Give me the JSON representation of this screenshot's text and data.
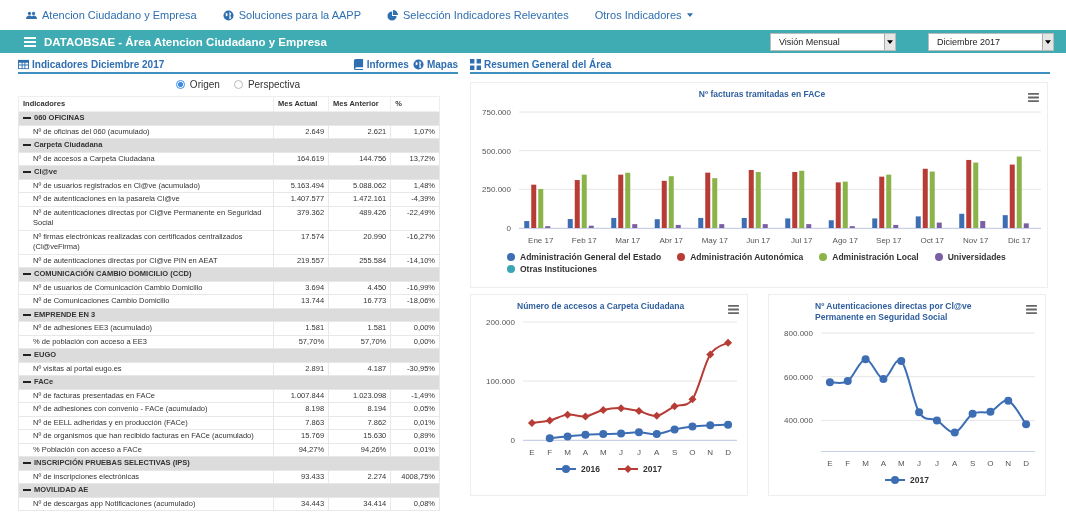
{
  "nav": {
    "items": [
      {
        "label": "Atencion Ciudadano y Empresa",
        "kind": "users"
      },
      {
        "label": "Soluciones para la AAPP",
        "kind": "globe"
      },
      {
        "label": "Selección Indicadores Relevantes",
        "kind": "pie"
      },
      {
        "label": "Otros Indicadores",
        "kind": "dropdown"
      }
    ]
  },
  "header": {
    "title": "DATAOBSAE - Área Atencion Ciudadano y Empresa",
    "selects": [
      {
        "value": "Visión Mensual"
      },
      {
        "value": "Diciembre 2017"
      }
    ]
  },
  "indicators": {
    "title": "Indicadores Diciembre 2017",
    "links": [
      {
        "label": "Informes",
        "kind": "book"
      },
      {
        "label": "Mapas",
        "kind": "globe"
      }
    ],
    "views": [
      {
        "label": "Origen",
        "selected": true
      },
      {
        "label": "Perspectiva",
        "selected": false
      }
    ],
    "columns": [
      "Indicadores",
      "Mes Actual",
      "Mes Anterior",
      "%"
    ],
    "sections": [
      {
        "title": "060 OFICINAS",
        "expanded": true,
        "rows": [
          [
            "Nº de oficinas del 060 (acumulado)",
            "2.649",
            "2.621",
            "1,07%"
          ]
        ]
      },
      {
        "title": "Carpeta Ciudadana",
        "expanded": true,
        "rows": [
          [
            "Nº de accesos a Carpeta Ciudadana",
            "164.619",
            "144.756",
            "13,72%"
          ]
        ]
      },
      {
        "title": "Cl@ve",
        "expanded": true,
        "rows": [
          [
            "Nº de usuarios registrados en Cl@ve (acumulado)",
            "5.163.494",
            "5.088.062",
            "1,48%"
          ],
          [
            "Nº de autenticaciones en la pasarela Cl@ve",
            "1.407.577",
            "1.472.161",
            "-4,39%"
          ],
          [
            "Nº de autenticaciones directas por Cl@ve Permanente en Seguridad Social",
            "379.362",
            "489.426",
            "-22,49%"
          ],
          [
            "Nº firmas electrónicas realizadas con certificados centralizados (Cl@veFirma)",
            "17.574",
            "20.990",
            "-16,27%"
          ],
          [
            "Nº de autenticaciones directas por Cl@ve PIN en AEAT",
            "219.557",
            "255.584",
            "-14,10%"
          ]
        ]
      },
      {
        "title": "COMUNICACIÓN CAMBIO DOMICILIO (CCD)",
        "expanded": true,
        "rows": [
          [
            "Nº de usuarios de Comunicación Cambio Domicilio",
            "3.694",
            "4.450",
            "-16,99%"
          ],
          [
            "Nº de Comunicaciones Cambio Domicilio",
            "13.744",
            "16.773",
            "-18,06%"
          ]
        ]
      },
      {
        "title": "EMPRENDE EN 3",
        "expanded": true,
        "rows": [
          [
            "Nº de adhesiones EE3 (acumulado)",
            "1.581",
            "1.581",
            "0,00%"
          ],
          [
            "% de población con acceso a EE3",
            "57,70%",
            "57,70%",
            "0,00%"
          ]
        ]
      },
      {
        "title": "EUGO",
        "expanded": true,
        "rows": [
          [
            "Nº visitas al portal eugo.es",
            "2.891",
            "4.187",
            "-30,95%"
          ]
        ]
      },
      {
        "title": "FACe",
        "expanded": true,
        "rows": [
          [
            "Nº de facturas presentadas en FACe",
            "1.007.844",
            "1.023.098",
            "-1,49%"
          ],
          [
            "Nº de adhesiones con convenio - FACe (acumulado)",
            "8.198",
            "8.194",
            "0,05%"
          ],
          [
            "Nº de EELL adheridas y en producción (FACe)",
            "7.863",
            "7.862",
            "0,01%"
          ],
          [
            "Nº de organismos que han recibido facturas en FACe (acumulado)",
            "15.769",
            "15.630",
            "0,89%"
          ],
          [
            "% Población con acceso a FACe",
            "94,27%",
            "94,26%",
            "0,01%"
          ]
        ]
      },
      {
        "title": "INSCRIPCIÓN PRUEBAS SELECTIVAS (IPS)",
        "expanded": true,
        "rows": [
          [
            "Nº de inscripciones electrónicas",
            "93.433",
            "2.274",
            "4008,75%"
          ]
        ]
      },
      {
        "title": "MOVILIDAD AE",
        "expanded": true,
        "rows": [
          [
            "Nº de descargas app Notificaciones (acumulado)",
            "34.443",
            "34.414",
            "0,08%"
          ]
        ]
      }
    ]
  },
  "summary": {
    "title": "Resumen General del Área",
    "charts": [
      {
        "chart_data": {
          "type": "bar",
          "title": "Nº facturas tramitadas en FACe",
          "legend": true,
          "categories": [
            "Ene 17",
            "Feb 17",
            "Mar 17",
            "Abr 17",
            "May 17",
            "Jun 17",
            "Jul 17",
            "Ago 17",
            "Sep 17",
            "Oct 17",
            "Nov 17",
            "Dic 17"
          ],
          "ylim": [
            0,
            750000
          ],
          "yticks": [
            {
              "value": 0,
              "label": "0"
            },
            {
              "value": 250000,
              "label": "250.000"
            },
            {
              "value": 500000,
              "label": "500.000"
            },
            {
              "value": 750000,
              "label": "750.000"
            }
          ],
          "series": [
            {
              "name": "Administración General del Estado",
              "color": "#3d6eb4",
              "values": [
                45000,
                58000,
                65000,
                57000,
                65000,
                65000,
                62000,
                50000,
                62000,
                75000,
                92000,
                83000
              ]
            },
            {
              "name": "Administración Autonómica",
              "color": "#b83c36",
              "values": [
                280000,
                310000,
                345000,
                305000,
                358000,
                375000,
                362000,
                295000,
                332000,
                383000,
                440000,
                410000
              ]
            },
            {
              "name": "Administración Local",
              "color": "#8ab34a",
              "values": [
                252000,
                345000,
                357000,
                335000,
                322000,
                362000,
                370000,
                300000,
                345000,
                365000,
                423000,
                462000
              ]
            },
            {
              "name": "Universidades",
              "color": "#7b5fa3",
              "values": [
                12000,
                15000,
                25000,
                20000,
                25000,
                25000,
                25000,
                12000,
                20000,
                35000,
                45000,
                30000
              ]
            },
            {
              "name": "Otras Instituciones",
              "color": "#3aa5b5",
              "values": [
                null,
                null,
                null,
                null,
                null,
                null,
                null,
                null,
                null,
                null,
                null,
                null
              ]
            }
          ]
        }
      },
      {
        "chart_data": {
          "type": "line",
          "title": "Número de accesos a Carpeta Ciudadana",
          "legend": true,
          "categories": [
            "E",
            "F",
            "M",
            "A",
            "M",
            "J",
            "J",
            "A",
            "S",
            "O",
            "N",
            "D"
          ],
          "ylim": [
            0,
            200000
          ],
          "yticks": [
            {
              "value": 0,
              "label": "0"
            },
            {
              "value": 100000,
              "label": "100.000"
            },
            {
              "value": 200000,
              "label": "200.000"
            }
          ],
          "series": [
            {
              "name": "2016",
              "color": "#3d6eb4",
              "marker": "circle",
              "values": [
                null,
                3000,
                6000,
                9000,
                10000,
                11000,
                13000,
                10000,
                18000,
                23000,
                25000,
                26000
              ]
            },
            {
              "name": "2017",
              "color": "#b83c36",
              "marker": "diamond",
              "values": [
                29000,
                33000,
                43000,
                40000,
                51000,
                54000,
                49000,
                41000,
                57000,
                69000,
                145000,
                165000
              ]
            }
          ]
        }
      },
      {
        "chart_data": {
          "type": "line",
          "title": "Nº Autenticaciones directas por Cl@ve Permanente en Seguridad Social",
          "legend": true,
          "categories": [
            "E",
            "F",
            "M",
            "A",
            "M",
            "J",
            "J",
            "A",
            "S",
            "O",
            "N",
            "D"
          ],
          "ylim": [
            260000,
            800000
          ],
          "yticks": [
            {
              "value": 400000,
              "label": "400.000"
            },
            {
              "value": 600000,
              "label": "600.000"
            },
            {
              "value": 800000,
              "label": "800.000"
            }
          ],
          "series": [
            {
              "name": "2017",
              "color": "#3d6eb4",
              "marker": "circle",
              "values": [
                575000,
                580000,
                680000,
                590000,
                672000,
                437000,
                400000,
                345000,
                430000,
                440000,
                490000,
                382000
              ]
            }
          ]
        }
      }
    ]
  }
}
